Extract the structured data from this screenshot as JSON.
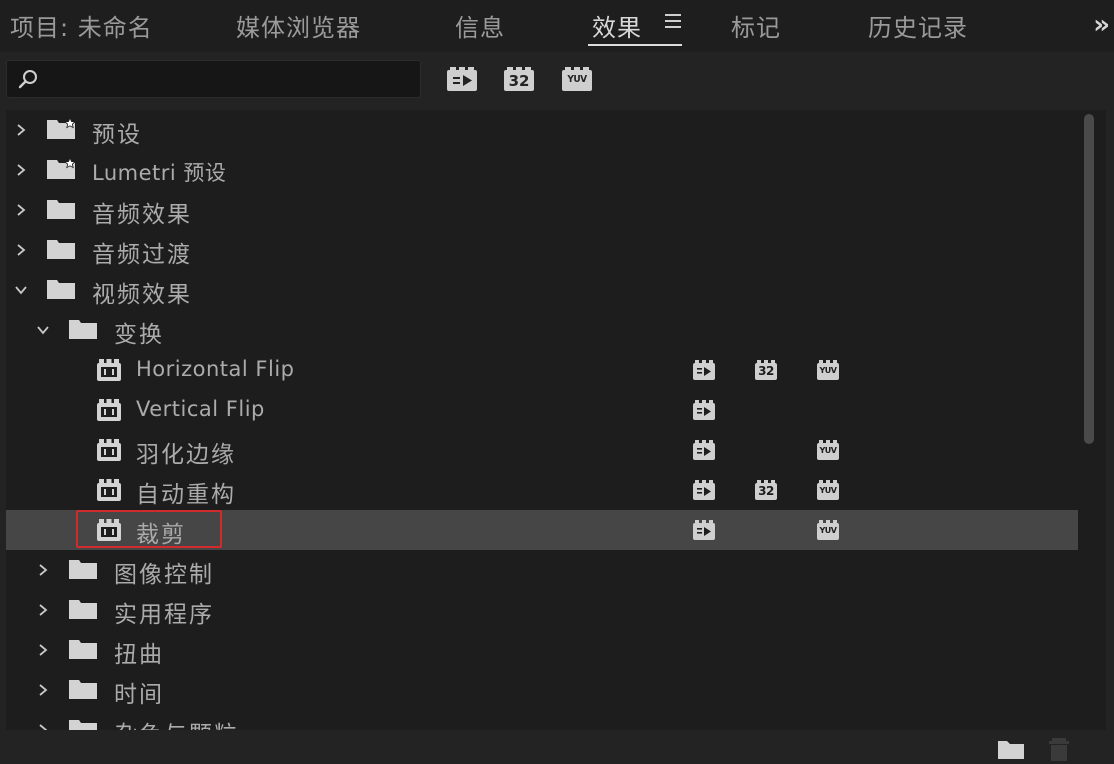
{
  "tabs": [
    {
      "label": "项目: 未命名",
      "active": false
    },
    {
      "label": "媒体浏览器",
      "active": false
    },
    {
      "label": "信息",
      "active": false
    },
    {
      "label": "效果",
      "active": true
    },
    {
      "label": "标记",
      "active": false
    },
    {
      "label": "历史记录",
      "active": false
    }
  ],
  "overflow_label": "»",
  "search": {
    "value": "",
    "placeholder": ""
  },
  "filter_buttons": [
    "accelerated-effects-icon",
    "32-bit-color-icon",
    "yuv-effects-icon"
  ],
  "badge_text": {
    "thirty_two": "32",
    "yuv": "YUV"
  },
  "tree": [
    {
      "label": "预设",
      "kind": "preset-folder",
      "level": 0,
      "expanded": false,
      "badges": []
    },
    {
      "label": "Lumetri 预设",
      "kind": "preset-folder",
      "level": 0,
      "expanded": false,
      "badges": []
    },
    {
      "label": "音频效果",
      "kind": "folder",
      "level": 0,
      "expanded": false,
      "badges": []
    },
    {
      "label": "音频过渡",
      "kind": "folder",
      "level": 0,
      "expanded": false,
      "badges": []
    },
    {
      "label": "视频效果",
      "kind": "folder",
      "level": 0,
      "expanded": true,
      "badges": []
    },
    {
      "label": "变换",
      "kind": "folder",
      "level": 1,
      "expanded": true,
      "badges": []
    },
    {
      "label": "Horizontal Flip",
      "kind": "effect",
      "level": 2,
      "badges": [
        "accel",
        "32",
        "yuv"
      ]
    },
    {
      "label": "Vertical Flip",
      "kind": "effect",
      "level": 2,
      "badges": [
        "accel"
      ]
    },
    {
      "label": "羽化边缘",
      "kind": "effect",
      "level": 2,
      "badges": [
        "accel",
        "yuv"
      ]
    },
    {
      "label": "自动重构",
      "kind": "effect",
      "level": 2,
      "badges": [
        "accel",
        "32",
        "yuv"
      ]
    },
    {
      "label": "裁剪",
      "kind": "effect",
      "level": 2,
      "selected": true,
      "badges": [
        "accel",
        "yuv"
      ]
    },
    {
      "label": "图像控制",
      "kind": "folder",
      "level": 1,
      "expanded": false,
      "badges": []
    },
    {
      "label": "实用程序",
      "kind": "folder",
      "level": 1,
      "expanded": false,
      "badges": []
    },
    {
      "label": "扭曲",
      "kind": "folder",
      "level": 1,
      "expanded": false,
      "badges": []
    },
    {
      "label": "时间",
      "kind": "folder",
      "level": 1,
      "expanded": false,
      "badges": []
    },
    {
      "label": "杂色与颗粒",
      "kind": "folder",
      "level": 1,
      "expanded": false,
      "badges": []
    }
  ],
  "bottom_buttons": [
    "new-folder-icon",
    "trash-icon"
  ],
  "colors": {
    "highlight": "#d12b2b",
    "selected_row": "#464646",
    "panel_bg": "#1d1d1d"
  }
}
